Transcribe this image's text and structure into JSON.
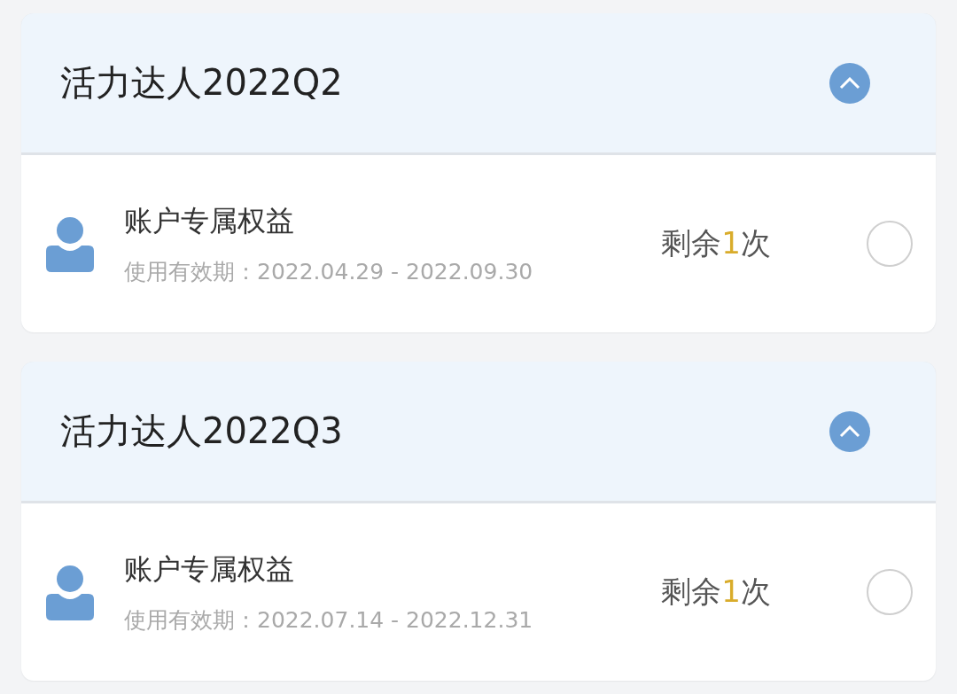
{
  "groups": [
    {
      "title": "活力达人2022Q2",
      "expanded": true,
      "items": [
        {
          "name": "账户专属权益",
          "validity": "使用有效期：2022.04.29 - 2022.09.30",
          "remaining": {
            "prefix": "剩余",
            "count": "1",
            "suffix": "次"
          },
          "selected": false
        }
      ]
    },
    {
      "title": "活力达人2022Q3",
      "expanded": true,
      "items": [
        {
          "name": "账户专属权益",
          "validity": "使用有效期：2022.07.14 - 2022.12.31",
          "remaining": {
            "prefix": "剩余",
            "count": "1",
            "suffix": "次"
          },
          "selected": false
        }
      ]
    }
  ]
}
